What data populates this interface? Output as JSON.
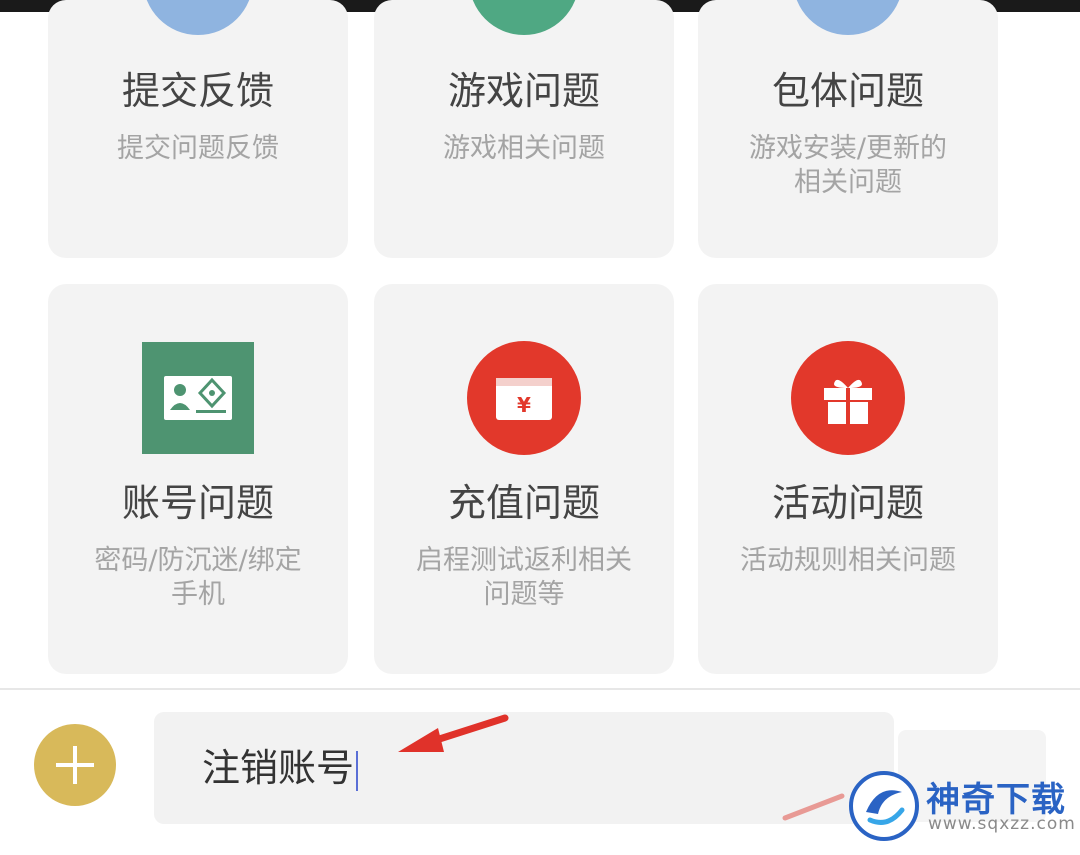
{
  "cards": [
    {
      "title": "提交反馈",
      "subtitle": "提交问题反馈",
      "icon": "feedback-icon",
      "color": "#8fb4e0"
    },
    {
      "title": "游戏问题",
      "subtitle": "游戏相关问题",
      "icon": "game-icon",
      "color": "#4fa883"
    },
    {
      "title": "包体问题",
      "subtitle": "游戏安装/更新的相关问题",
      "icon": "package-icon",
      "color": "#8fb4e0"
    },
    {
      "title": "账号问题",
      "subtitle": "密码/防沉迷/绑定手机",
      "icon": "id-card-icon",
      "color": "#4e9471"
    },
    {
      "title": "充值问题",
      "subtitle": "启程测试返利相关问题等",
      "icon": "recharge-icon",
      "color": "#e2382b"
    },
    {
      "title": "活动问题",
      "subtitle": "活动规则相关问题",
      "icon": "gift-icon",
      "color": "#e2382b"
    }
  ],
  "input": {
    "value": "注销账号"
  },
  "watermark": {
    "name": "神奇下载",
    "url": "www.sqxzz.com"
  },
  "colors": {
    "plus_button": "#d8b95a",
    "arrow": "#e0322a"
  }
}
